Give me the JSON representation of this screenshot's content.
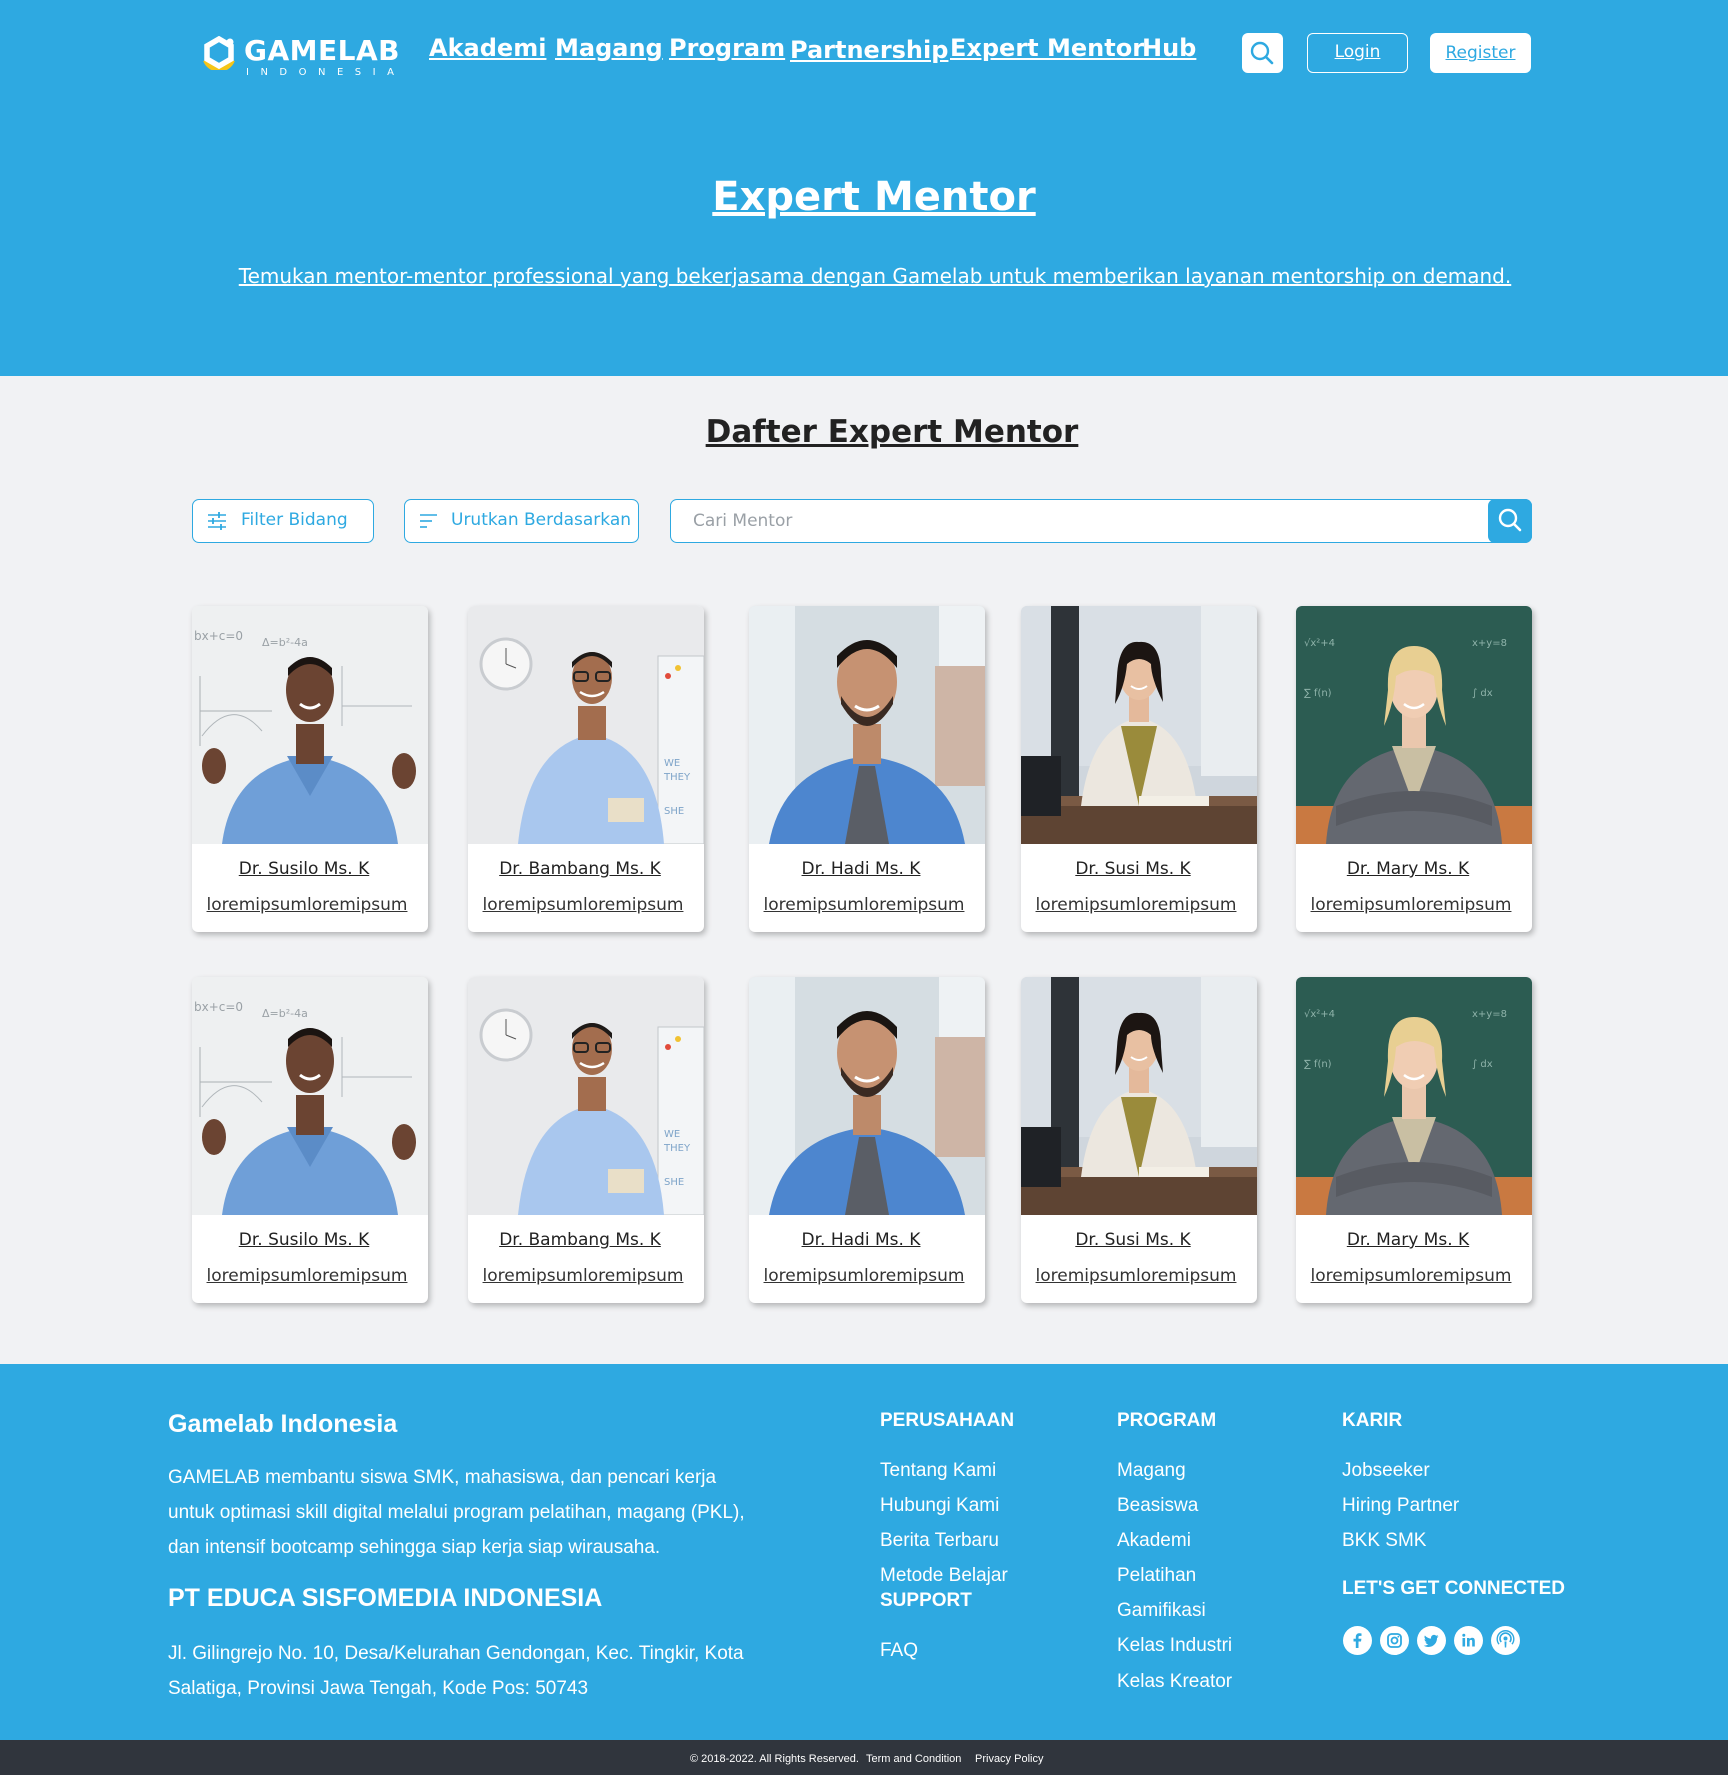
{
  "brand": {
    "logo_text": "GAMELAB",
    "logo_sub": "INDONESIA",
    "accent": "#2ea9e1",
    "logo_ring": "#f5c518"
  },
  "nav": [
    {
      "label": "Akademi"
    },
    {
      "label": "Magang"
    },
    {
      "label": "Program"
    },
    {
      "label": "Partnership"
    },
    {
      "label": "Expert Mentor"
    },
    {
      "label": "Hub"
    }
  ],
  "header": {
    "search_icon": "search-icon",
    "login_label": "Login",
    "register_label": "Register"
  },
  "hero": {
    "title": "Expert Mentor",
    "subtitle": "Temukan mentor-mentor professional yang bekerjasama dengan Gamelab untuk memberikan layanan mentorship on demand."
  },
  "list": {
    "title": "Dafter Expert Mentor",
    "filter_label": "Filter Bidang",
    "filter_icon": "sliders-icon",
    "sort_label": "Urutkan Berdasarkan",
    "sort_icon": "sort-icon",
    "search_placeholder": "Cari Mentor"
  },
  "mentors": [
    {
      "name": "Dr. Susilo Ms. K",
      "desc": "loremipsumloremipsum"
    },
    {
      "name": "Dr. Bambang Ms. K",
      "desc": "loremipsumloremipsum"
    },
    {
      "name": "Dr. Hadi Ms. K",
      "desc": "loremipsumloremipsum"
    },
    {
      "name": "Dr. Susi Ms. K",
      "desc": "loremipsumloremipsum"
    },
    {
      "name": "Dr. Mary Ms. K",
      "desc": "loremipsumloremipsum"
    },
    {
      "name": "Dr. Susilo Ms. K",
      "desc": "loremipsumloremipsum"
    },
    {
      "name": "Dr. Bambang Ms. K",
      "desc": "loremipsumloremipsum"
    },
    {
      "name": "Dr. Hadi Ms. K",
      "desc": "loremipsumloremipsum"
    },
    {
      "name": "Dr. Susi Ms. K",
      "desc": "loremipsumloremipsum"
    },
    {
      "name": "Dr. Mary Ms. K",
      "desc": "loremipsumloremipsum"
    }
  ],
  "footer": {
    "brand": "Gamelab Indonesia",
    "description": "GAMELAB membantu siswa SMK, mahasiswa, dan pencari kerja untuk optimasi skill digital melalui program pelatihan, magang (PKL), dan intensif bootcamp sehingga siap kerja siap wirausaha.",
    "company": "PT EDUCA SISFOMEDIA INDONESIA",
    "address": "Jl. Gilingrejo No. 10, Desa/Kelurahan Gendongan, Kec. Tingkir, Kota Salatiga, Provinsi Jawa Tengah, Kode Pos: 50743",
    "perusahaan": {
      "title": "PERUSAHAAN",
      "links": [
        "Tentang Kami",
        "Hubungi Kami",
        "Berita Terbaru",
        "Metode Belajar"
      ]
    },
    "support": {
      "title": "SUPPORT",
      "links": [
        "FAQ"
      ]
    },
    "program": {
      "title": "PROGRAM",
      "links": [
        "Magang",
        "Beasiswa",
        "Akademi",
        "Pelatihan",
        "Gamifikasi",
        "Kelas Industri",
        "Kelas Kreator"
      ]
    },
    "karir": {
      "title": "KARIR",
      "links": [
        "Jobseeker",
        "Hiring Partner",
        "BKK SMK"
      ]
    },
    "connected": "LET'S GET CONNECTED",
    "socials": [
      "facebook-icon",
      "instagram-icon",
      "twitter-icon",
      "linkedin-icon",
      "podcast-icon"
    ]
  },
  "bottom": {
    "copyright": "© 2018-2022. All Rights Reserved.",
    "terms": "Term and Condition",
    "privacy": "Privacy Policy",
    "bar_color": "#30353d"
  }
}
